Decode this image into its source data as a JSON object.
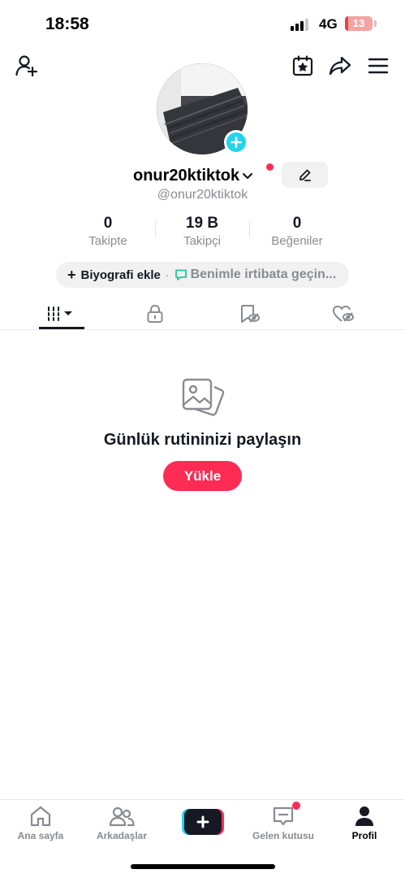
{
  "status_bar": {
    "time": "18:58",
    "network": "4G",
    "battery": "13",
    "battery_level_percent": 13
  },
  "header": {
    "icons": [
      "add-user-icon",
      "calendar-star-icon",
      "share-icon",
      "menu-icon"
    ]
  },
  "profile": {
    "username": "onur20ktiktok",
    "handle": "@onur20ktiktok",
    "stats": [
      {
        "value": "0",
        "label": "Takipte"
      },
      {
        "value": "19 B",
        "label": "Takipçi"
      },
      {
        "value": "0",
        "label": "Beğeniler"
      }
    ],
    "bio_add_label": "Biyografi ekle",
    "bio_separator": "·",
    "contact_label": "Benimle irtibata geçin..."
  },
  "tabs": [
    "videos-grid-icon",
    "lock-icon",
    "saved-icon",
    "liked-icon"
  ],
  "empty_state": {
    "title": "Günlük rutininizi paylaşın",
    "button": "Yükle"
  },
  "bottom_nav": {
    "items": [
      {
        "label": "Ana sayfa",
        "icon": "home-icon"
      },
      {
        "label": "Arkadaşlar",
        "icon": "friends-icon"
      },
      {
        "label": "",
        "icon": "create-icon"
      },
      {
        "label": "Gelen kutusu",
        "icon": "inbox-icon"
      },
      {
        "label": "Profil",
        "icon": "profile-icon"
      }
    ]
  },
  "colors": {
    "accent": "#fe2c55",
    "cyan": "#20d5ec",
    "text": "#161823",
    "muted": "#8a8b91"
  }
}
